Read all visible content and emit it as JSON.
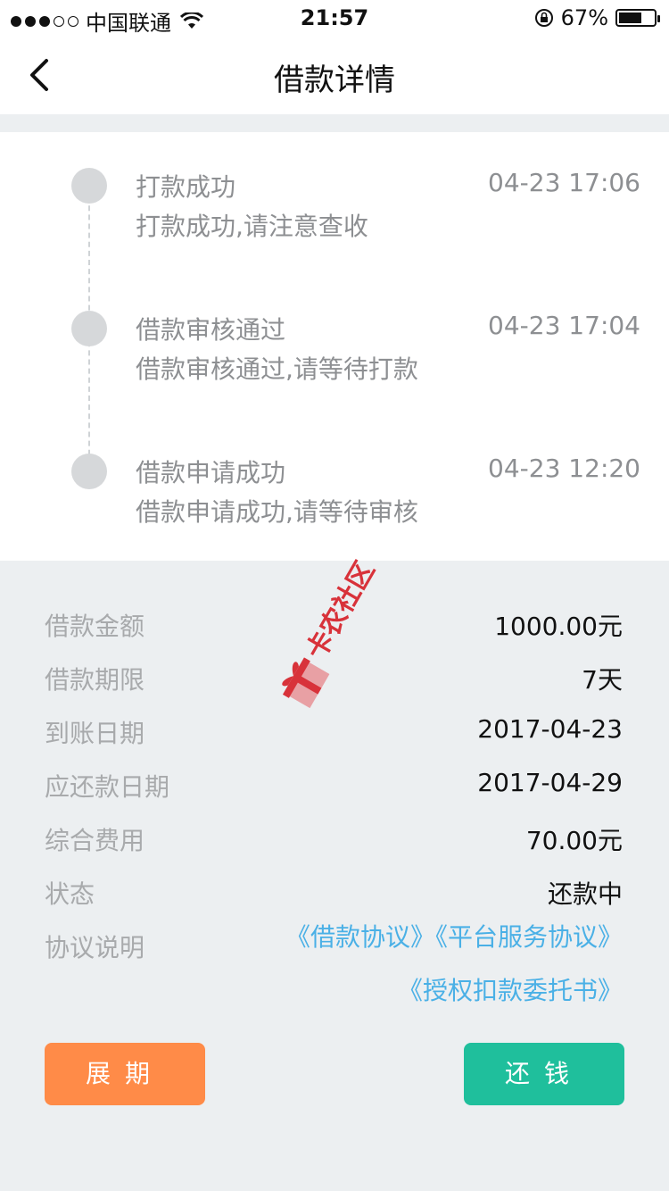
{
  "status_bar": {
    "carrier": "中国联通",
    "time": "21:57",
    "battery": "67%",
    "battery_level": 0.67
  },
  "nav": {
    "title": "借款详情"
  },
  "timeline": [
    {
      "title": "打款成功",
      "time": "04-23 17:06",
      "desc": "打款成功,请注意查收"
    },
    {
      "title": "借款审核通过",
      "time": "04-23 17:04",
      "desc": "借款审核通过,请等待打款"
    },
    {
      "title": "借款申请成功",
      "time": "04-23 12:20",
      "desc": "借款申请成功,请等待审核"
    }
  ],
  "details": [
    {
      "label": "借款金额",
      "value": "1000.00元"
    },
    {
      "label": "借款期限",
      "value": "7天"
    },
    {
      "label": "到账日期",
      "value": "2017-04-23"
    },
    {
      "label": "应还款日期",
      "value": "2017-04-29"
    },
    {
      "label": "综合费用",
      "value": "70.00元"
    },
    {
      "label": "状态",
      "value": "还款中"
    },
    {
      "label": "协议说明",
      "value": ""
    }
  ],
  "agreements": [
    "《借款协议》",
    "《平台服务协议》",
    "《授权扣款委托书》"
  ],
  "buttons": {
    "extend": "展期",
    "repay": "还钱"
  },
  "watermark": {
    "text": "卡农社区"
  },
  "colors": {
    "accent_orange": "#ff8b48",
    "accent_green": "#1fbf9c",
    "link_blue": "#4ab0e6"
  }
}
